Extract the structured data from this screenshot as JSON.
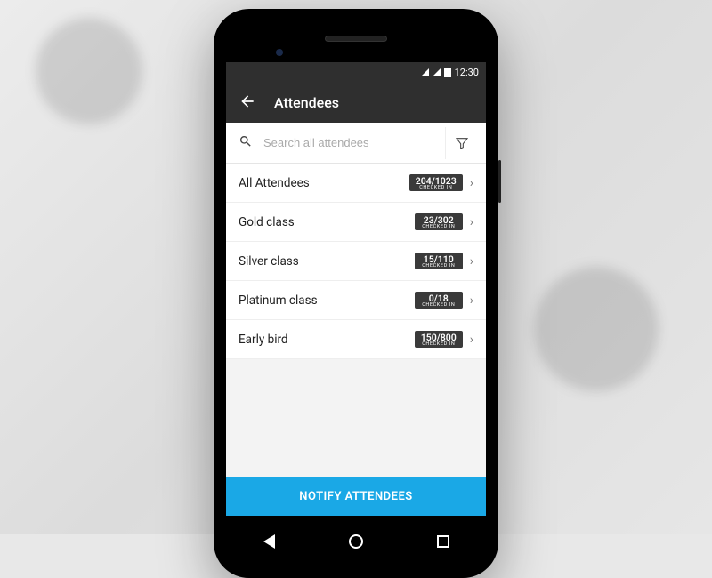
{
  "statusbar": {
    "time": "12:30"
  },
  "appbar": {
    "title": "Attendees"
  },
  "search": {
    "placeholder": "Search all attendees"
  },
  "categories": [
    {
      "label": "All Attendees",
      "count": "204/1023",
      "sub": "CHECKED IN"
    },
    {
      "label": "Gold class",
      "count": "23/302",
      "sub": "CHECKED IN"
    },
    {
      "label": "Silver class",
      "count": "15/110",
      "sub": "CHECKED IN"
    },
    {
      "label": "Platinum class",
      "count": "0/18",
      "sub": "CHECKED IN"
    },
    {
      "label": "Early bird",
      "count": "150/800",
      "sub": "CHECKED IN"
    }
  ],
  "notify_label": "NOTIFY ATTENDEES"
}
